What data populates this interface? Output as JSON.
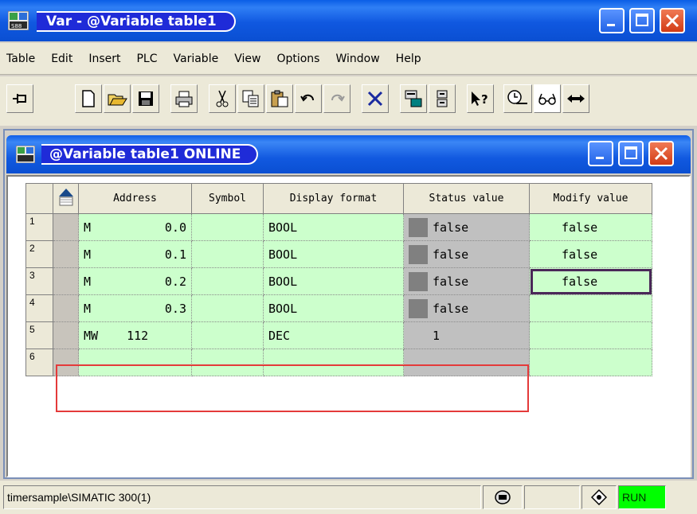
{
  "window": {
    "title": "Var - @Variable table1",
    "icon": "s7-app-icon"
  },
  "menu": [
    "Table",
    "Edit",
    "Insert",
    "PLC",
    "Variable",
    "View",
    "Options",
    "Window",
    "Help"
  ],
  "toolbar": {
    "icons": [
      "pin-icon",
      "new-icon",
      "open-icon",
      "save-icon",
      "print-icon",
      "cut-icon",
      "copy-icon",
      "paste-icon",
      "undo-icon",
      "redo-icon",
      "delete-icon",
      "online-icon",
      "offline-icon",
      "help-icon",
      "monitor-icon",
      "glasses-icon",
      "modify-icon"
    ],
    "help_label": "?"
  },
  "subwindow": {
    "title": "@Variable table1  ONLINE"
  },
  "table": {
    "headers": {
      "address": "Address",
      "symbol": "Symbol",
      "display_format": "Display format",
      "status_value": "Status value",
      "modify_value": "Modify value"
    },
    "rows": [
      {
        "num": "1",
        "area": "M",
        "addr": "0.0",
        "symbol": "",
        "format": "BOOL",
        "status": "false",
        "modify": "false"
      },
      {
        "num": "2",
        "area": "M",
        "addr": "0.1",
        "symbol": "",
        "format": "BOOL",
        "status": "false",
        "modify": "false"
      },
      {
        "num": "3",
        "area": "M",
        "addr": "0.2",
        "symbol": "",
        "format": "BOOL",
        "status": "false",
        "modify": "false"
      },
      {
        "num": "4",
        "area": "M",
        "addr": "0.3",
        "symbol": "",
        "format": "BOOL",
        "status": "false",
        "modify": ""
      },
      {
        "num": "5",
        "area": "MW",
        "addr": "112",
        "symbol": "",
        "format": "DEC",
        "status": "1",
        "modify": ""
      },
      {
        "num": "6",
        "area": "",
        "addr": "",
        "symbol": "",
        "format": "",
        "status": "",
        "modify": ""
      }
    ]
  },
  "status_bar": {
    "path": "timersample\\SIMATIC 300(1)",
    "mode": "RUN"
  },
  "colors": {
    "titlebar": "#0a5ee6",
    "cell_green": "#ccffcc",
    "status_gray": "#c0c0c0",
    "highlight_red": "#e43a3a",
    "run_green": "#00ff00"
  }
}
